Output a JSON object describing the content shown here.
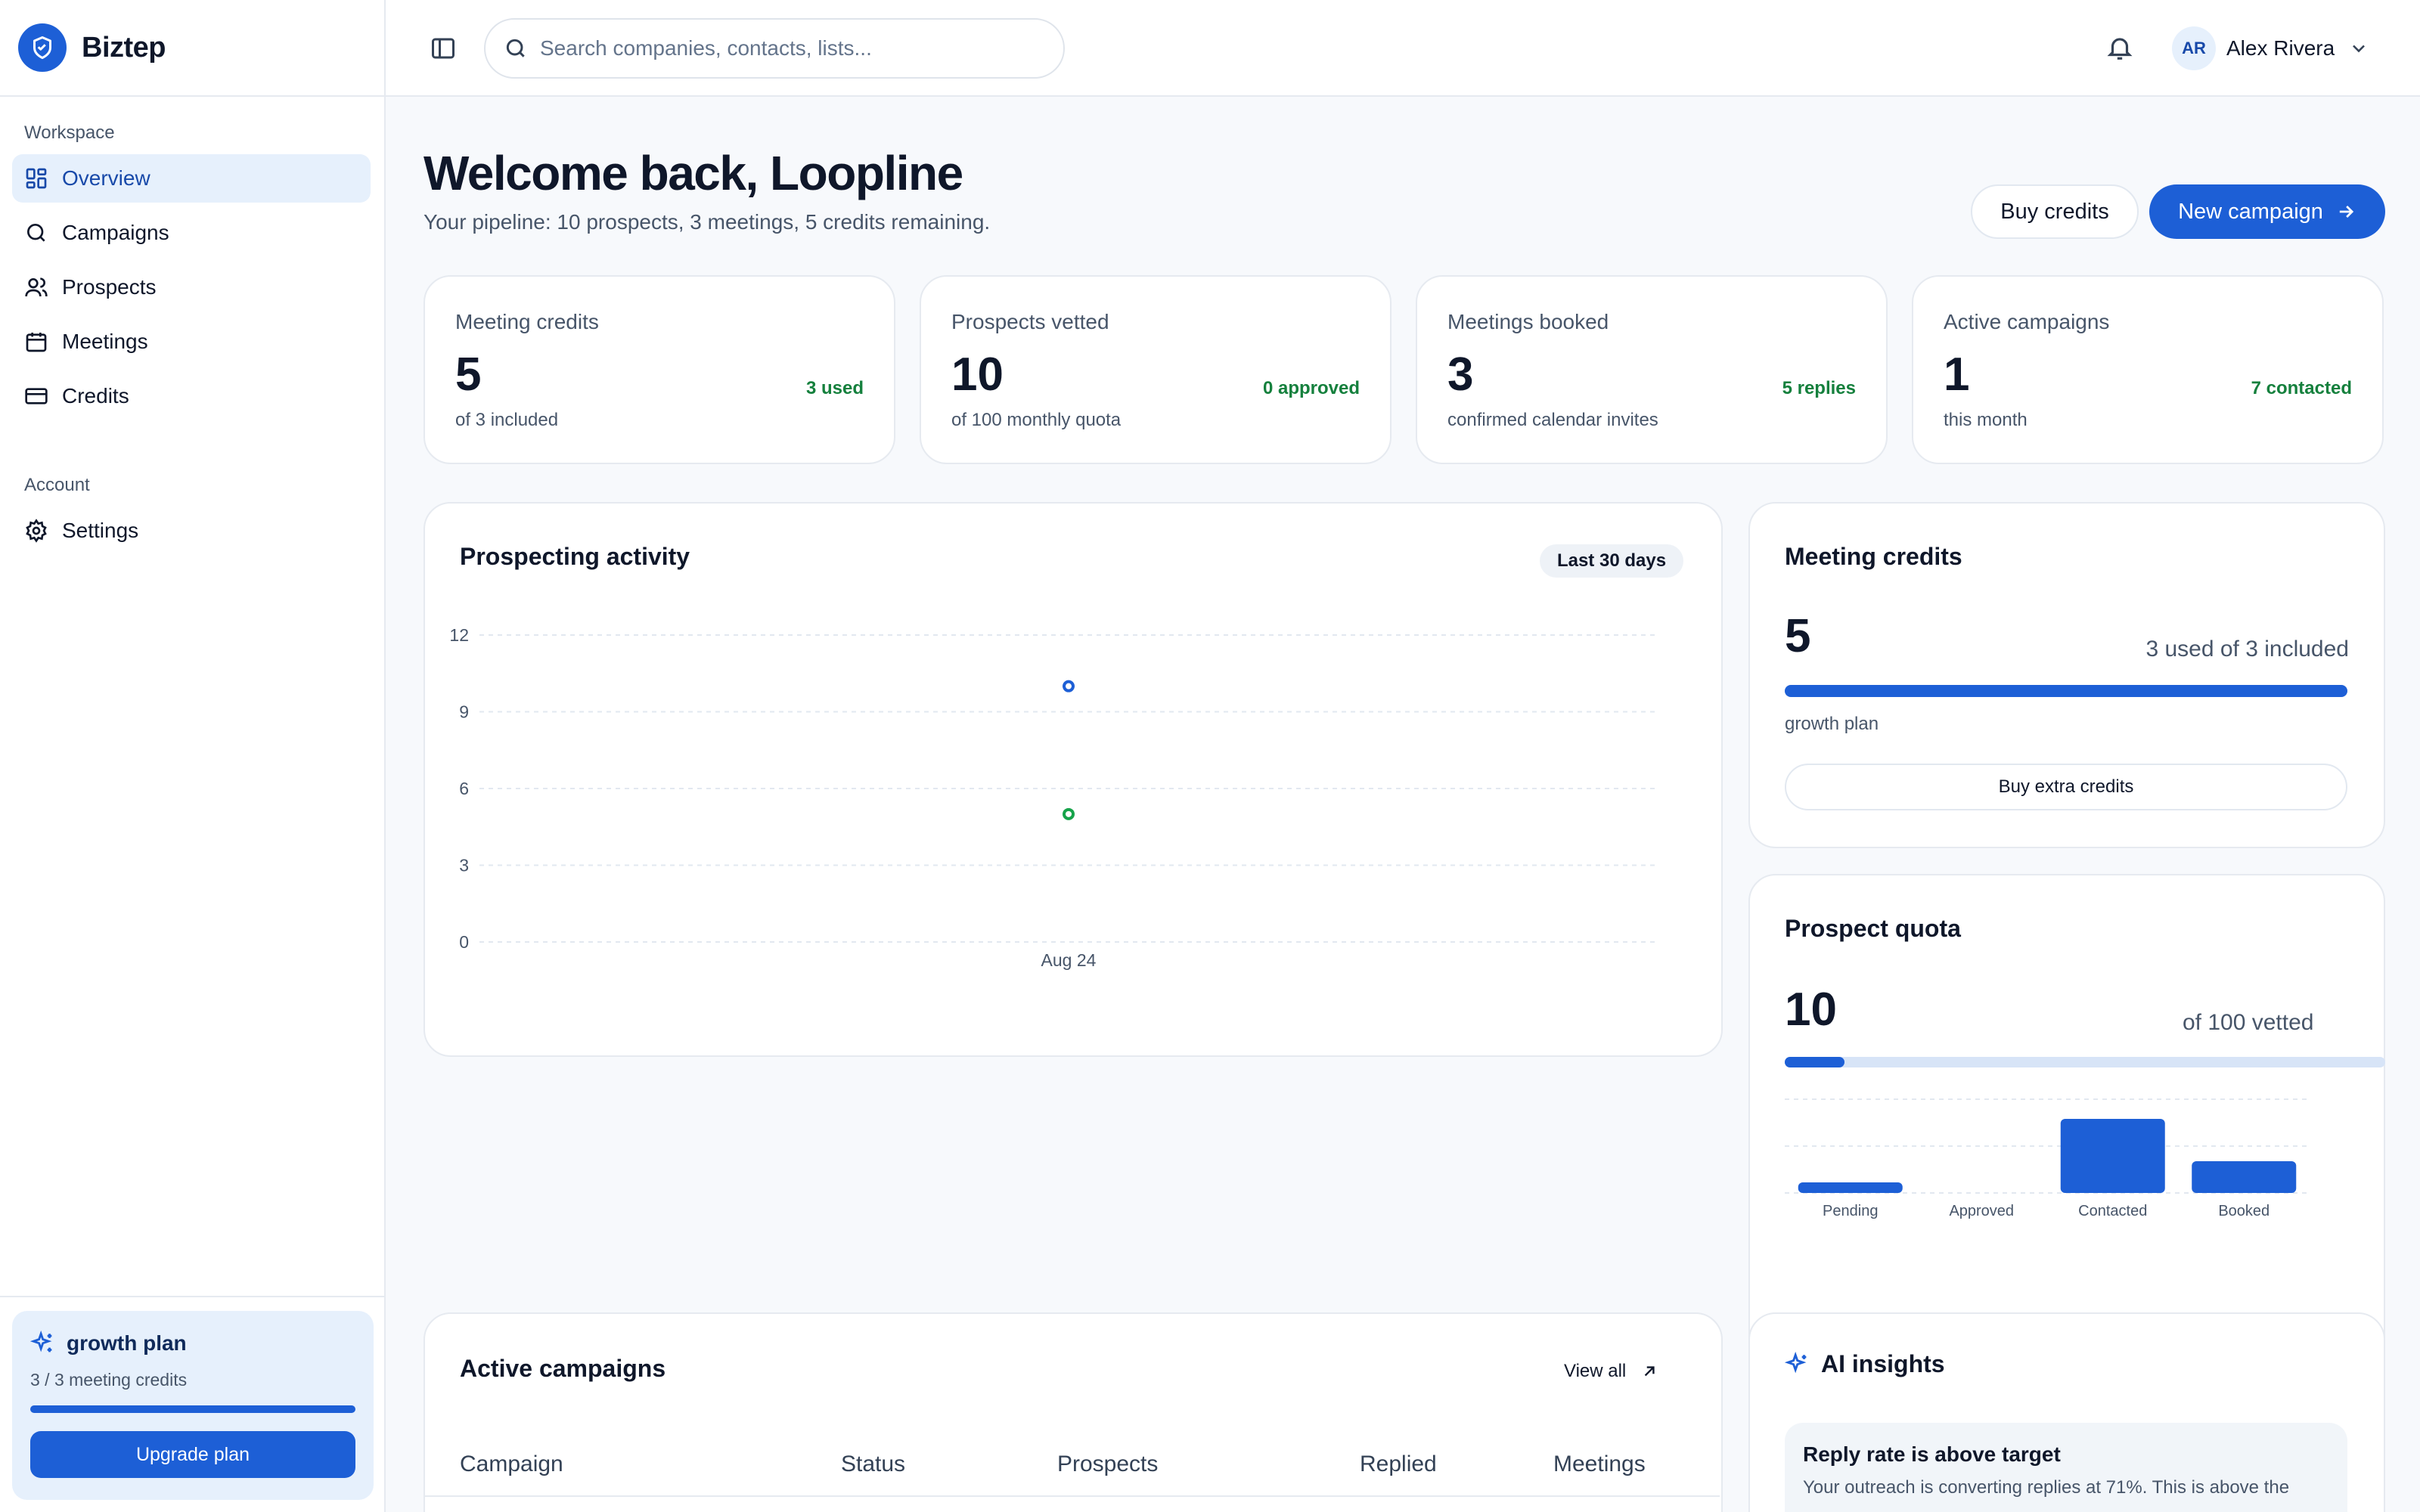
{
  "brand": {
    "name": "Biztep"
  },
  "sidebar": {
    "workspace_title": "Workspace",
    "items": [
      {
        "label": "Overview",
        "icon": "grid-icon",
        "active": true
      },
      {
        "label": "Campaigns",
        "icon": "search-icon"
      },
      {
        "label": "Prospects",
        "icon": "users-icon"
      },
      {
        "label": "Meetings",
        "icon": "calendar-icon"
      },
      {
        "label": "Credits",
        "icon": "credit-card-icon"
      }
    ],
    "account_title": "Account",
    "account_items": [
      {
        "label": "Settings",
        "icon": "gear-icon"
      }
    ],
    "plan": {
      "name": "growth plan",
      "credits": "3 / 3 meeting credits",
      "progress": 1.0,
      "button": "Upgrade plan"
    }
  },
  "topbar": {
    "search_placeholder": "Search companies, contacts, lists...",
    "user": {
      "initials": "AR",
      "name": "Alex Rivera"
    }
  },
  "header": {
    "title": "Welcome back, Loopline",
    "subtitle": "Your pipeline: 10 prospects, 3 meetings, 5 credits remaining.",
    "buy_credits": "Buy credits",
    "new_campaign": "New campaign"
  },
  "stats": [
    {
      "label": "Meeting credits",
      "value": "5",
      "foot": "of 3 included",
      "delta": "3 used"
    },
    {
      "label": "Prospects vetted",
      "value": "10",
      "foot": "of 100 monthly quota",
      "delta": "0 approved"
    },
    {
      "label": "Meetings booked",
      "value": "3",
      "foot": "confirmed calendar invites",
      "delta": "5 replies"
    },
    {
      "label": "Active campaigns",
      "value": "1",
      "foot": "this month",
      "delta": "7 contacted"
    }
  ],
  "activity": {
    "title": "Prospecting activity",
    "range": "Last 30 days"
  },
  "meeting_credits_card": {
    "title": "Meeting credits",
    "value": "5",
    "detail": "3 used of 3 included",
    "progress": 1.0,
    "plan": "growth plan",
    "button": "Buy extra credits"
  },
  "prospect_quota_card": {
    "title": "Prospect quota",
    "value": "10",
    "detail": "of 100 vetted",
    "progress": 0.1
  },
  "campaigns_table": {
    "title": "Active campaigns",
    "view_all": "View all",
    "columns": [
      "Campaign",
      "Status",
      "Prospects",
      "Replied",
      "Meetings"
    ]
  },
  "ai_insights": {
    "title": "AI insights",
    "items": [
      {
        "title": "Reply rate is above target",
        "body": "Your outreach is converting replies at 71%. This is above the"
      }
    ]
  },
  "colors": {
    "primary": "#1d5fd6",
    "accent_green": "#15803d",
    "series_green": "#16a34a"
  },
  "chart_data": [
    {
      "type": "scatter",
      "title": "Prospecting activity",
      "x": [
        "Aug 24"
      ],
      "series": [
        {
          "values": [
            10
          ],
          "color": "#1d5fd6"
        },
        {
          "values": [
            5
          ],
          "color": "#16a34a"
        }
      ],
      "ylim": [
        0,
        12
      ],
      "yticks": [
        0,
        3,
        6,
        9,
        12
      ],
      "xticks": [
        "Aug 24"
      ],
      "grid": true
    },
    {
      "type": "bar",
      "title": "Prospect quota",
      "categories": [
        "Pending",
        "Approved",
        "Contacted",
        "Booked"
      ],
      "values": [
        1,
        0,
        7,
        3
      ],
      "grid": true
    }
  ]
}
